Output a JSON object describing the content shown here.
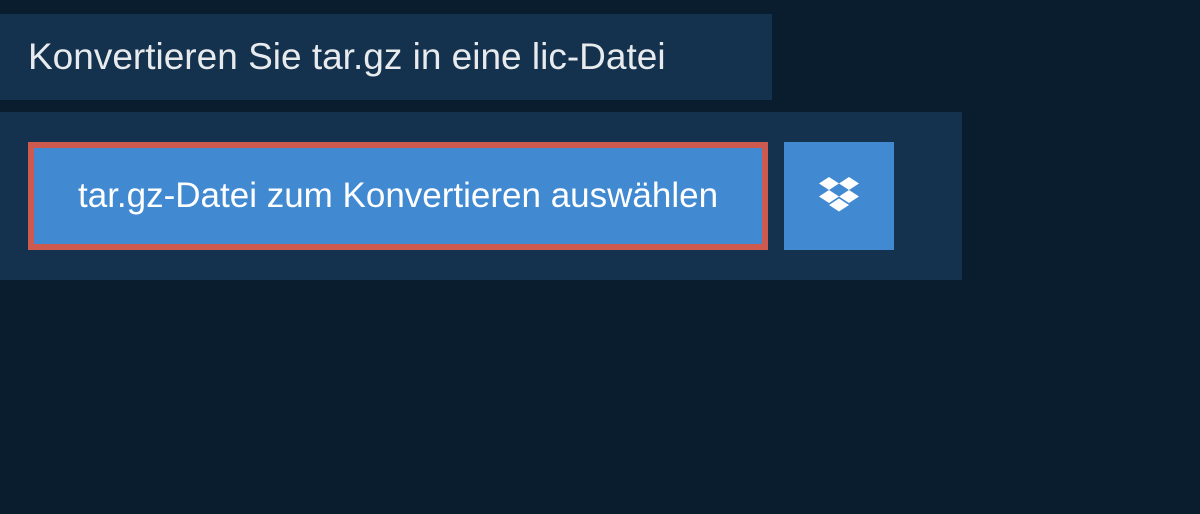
{
  "header": {
    "title": "Konvertieren Sie tar.gz in eine lic-Datei"
  },
  "upload": {
    "select_label": "tar.gz-Datei zum Konvertieren auswählen"
  },
  "colors": {
    "bg_page": "#0a1d2e",
    "bg_panel": "#14314d",
    "btn_blue": "#4189d0",
    "highlight": "#ce5a4f"
  }
}
